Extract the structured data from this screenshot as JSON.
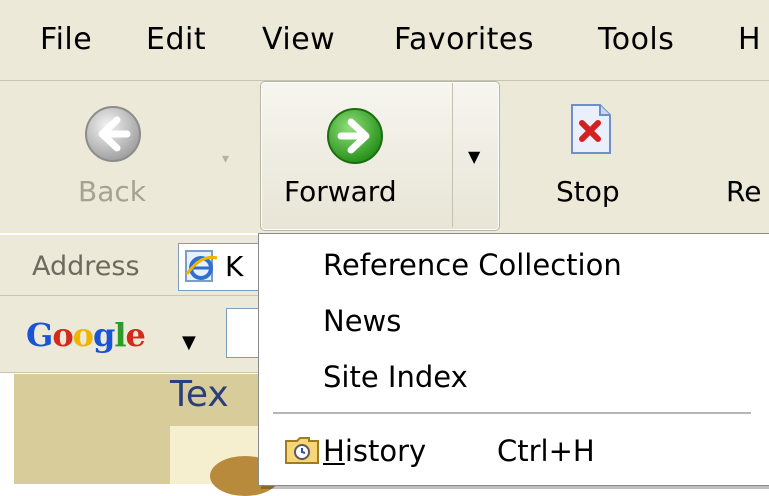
{
  "menubar": {
    "items": [
      "File",
      "Edit",
      "View",
      "Favorites",
      "Tools",
      "H"
    ]
  },
  "toolbar": {
    "back_label": "Back",
    "forward_label": "Forward",
    "stop_label": "Stop",
    "refresh_partial": "Re"
  },
  "address": {
    "label": "Address",
    "value_partial": "K"
  },
  "googlebar": {
    "logo": "Google"
  },
  "page": {
    "title_partial": "Tex"
  },
  "dropdown": {
    "items": [
      "Reference Collection",
      "News",
      "Site Index"
    ],
    "history_label_first": "H",
    "history_label_rest": "istory",
    "history_shortcut": "Ctrl+H"
  },
  "colors": {
    "chrome": "#ece9d8",
    "forward_green": "#2e9b1f",
    "back_gray": "#a9a9a9",
    "stop_red": "#d42020"
  },
  "icons": {
    "back": "back-arrow-icon",
    "forward": "forward-arrow-icon",
    "stop": "stop-icon",
    "ie": "ie-page-icon",
    "history": "history-folder-icon"
  }
}
